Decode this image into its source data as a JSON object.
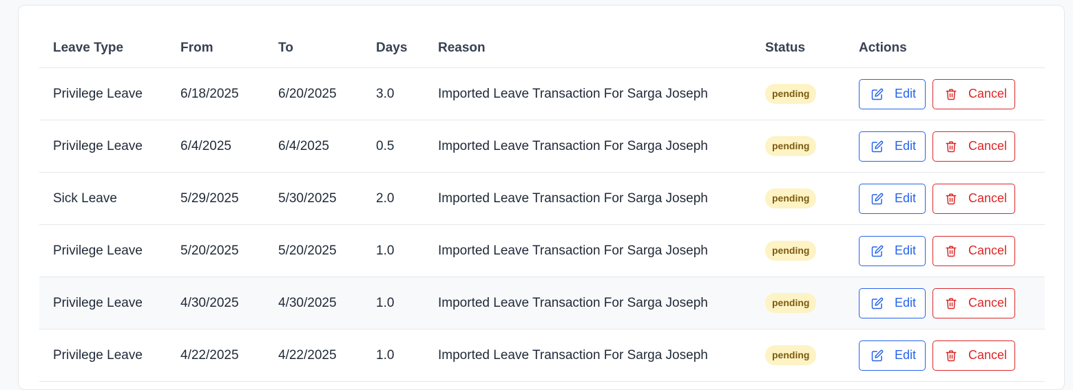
{
  "table": {
    "headers": {
      "leave_type": "Leave Type",
      "from": "From",
      "to": "To",
      "days": "Days",
      "reason": "Reason",
      "status": "Status",
      "actions": "Actions"
    },
    "actions": {
      "edit_label": "Edit",
      "cancel_label": "Cancel",
      "edit_icon": "edit-icon",
      "cancel_icon": "trash-icon"
    },
    "rows": [
      {
        "leave_type": "Privilege Leave",
        "from": "6/18/2025",
        "to": "6/20/2025",
        "days": "3.0",
        "reason": "Imported Leave Transaction For Sarga Joseph",
        "status": "pending"
      },
      {
        "leave_type": "Privilege Leave",
        "from": "6/4/2025",
        "to": "6/4/2025",
        "days": "0.5",
        "reason": "Imported Leave Transaction For Sarga Joseph",
        "status": "pending"
      },
      {
        "leave_type": "Sick Leave",
        "from": "5/29/2025",
        "to": "5/30/2025",
        "days": "2.0",
        "reason": "Imported Leave Transaction For Sarga Joseph",
        "status": "pending"
      },
      {
        "leave_type": "Privilege Leave",
        "from": "5/20/2025",
        "to": "5/20/2025",
        "days": "1.0",
        "reason": "Imported Leave Transaction For Sarga Joseph",
        "status": "pending"
      },
      {
        "leave_type": "Privilege Leave",
        "from": "4/30/2025",
        "to": "4/30/2025",
        "days": "1.0",
        "reason": "Imported Leave Transaction For Sarga Joseph",
        "status": "pending"
      },
      {
        "leave_type": "Privilege Leave",
        "from": "4/22/2025",
        "to": "4/22/2025",
        "days": "1.0",
        "reason": "Imported Leave Transaction For Sarga Joseph",
        "status": "pending"
      }
    ]
  },
  "colors": {
    "edit_accent": "#2563eb",
    "cancel_accent": "#dc2626",
    "pending_bg": "#fdf3c4",
    "pending_text": "#7c5a10",
    "row_hover": "#f8f9fb"
  }
}
